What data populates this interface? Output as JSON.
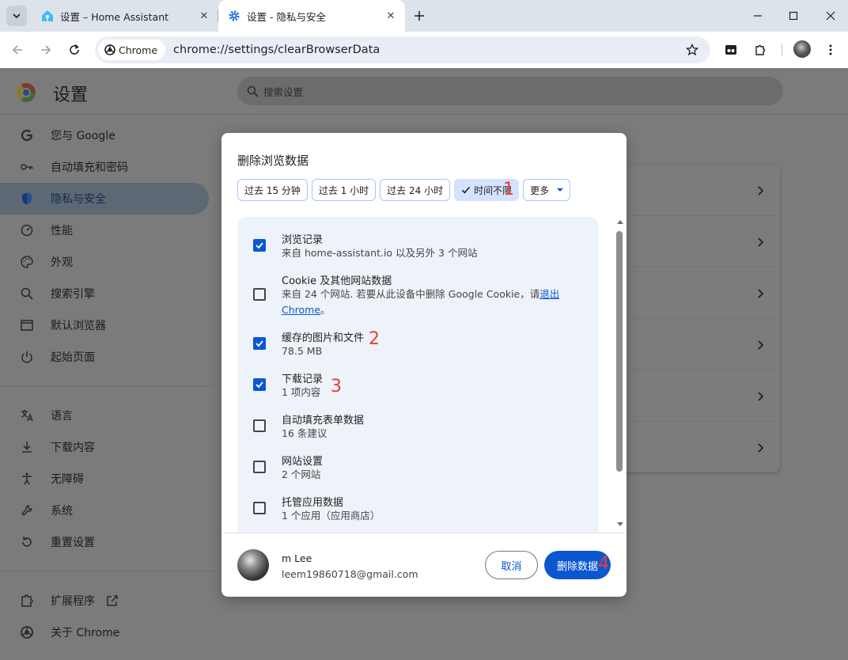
{
  "browser": {
    "tabs": [
      {
        "title": "设置 – Home Assistant",
        "icon": "home-assistant-icon",
        "active": false
      },
      {
        "title": "设置 - 隐私与安全",
        "icon": "gear-icon",
        "active": true
      }
    ],
    "omnibox": {
      "chip_label": "Chrome",
      "url": "chrome://settings/clearBrowserData"
    }
  },
  "settings": {
    "title": "设置",
    "search_placeholder": "搜索设置",
    "sidebar": [
      {
        "label": "您与 Google",
        "icon": "google-icon"
      },
      {
        "label": "自动填充和密码",
        "icon": "key-icon"
      },
      {
        "label": "隐私与安全",
        "icon": "shield-icon",
        "selected": true
      },
      {
        "label": "性能",
        "icon": "speedometer-icon"
      },
      {
        "label": "外观",
        "icon": "palette-icon"
      },
      {
        "label": "搜索引擎",
        "icon": "search-icon"
      },
      {
        "label": "默认浏览器",
        "icon": "browser-window-icon"
      },
      {
        "label": "起始页面",
        "icon": "power-icon"
      },
      {
        "label": "语言",
        "icon": "translate-icon"
      },
      {
        "label": "下载内容",
        "icon": "download-icon"
      },
      {
        "label": "无障碍",
        "icon": "accessibility-icon"
      },
      {
        "label": "系统",
        "icon": "wrench-icon"
      },
      {
        "label": "重置设置",
        "icon": "reset-icon"
      },
      {
        "label": "扩展程序",
        "icon": "puzzle-icon"
      },
      {
        "label": "关于 Chrome",
        "icon": "chrome-icon"
      }
    ]
  },
  "dialog": {
    "title": "删除浏览数据",
    "time_ranges": [
      "过去 15 分钟",
      "过去 1 小时",
      "过去 24 小时",
      "时间不限"
    ],
    "selected_range": "时间不限",
    "more_label": "更多",
    "items": [
      {
        "title": "浏览记录",
        "subtitle": "来自 home-assistant.io 以及另外 3 个网站",
        "checked": true
      },
      {
        "title": "Cookie 及其他网站数据",
        "subtitle_prefix": "来自 24 个网站. 若要从此设备中删除 Google Cookie，请",
        "subtitle_link": "退出 Chrome",
        "subtitle_suffix": "。",
        "checked": false
      },
      {
        "title": "缓存的图片和文件",
        "subtitle": "78.5 MB",
        "checked": true
      },
      {
        "title": "下载记录",
        "subtitle": "1 项内容",
        "checked": true
      },
      {
        "title": "自动填充表单数据",
        "subtitle": "16 条建议",
        "checked": false
      },
      {
        "title": "网站设置",
        "subtitle": "2 个网站",
        "checked": false
      },
      {
        "title": "托管应用数据",
        "subtitle": "1 个应用（应用商店）",
        "checked": false
      }
    ],
    "account": {
      "name": "m Lee",
      "email": "leem19860718@gmail.com"
    },
    "cancel_label": "取消",
    "delete_label": "删除数据",
    "annotations": [
      "1",
      "2",
      "3",
      "4"
    ]
  },
  "colors": {
    "accent": "#0b57d0",
    "annotation": "#ea3b3b",
    "chip_selected": "#d3e3fd"
  }
}
